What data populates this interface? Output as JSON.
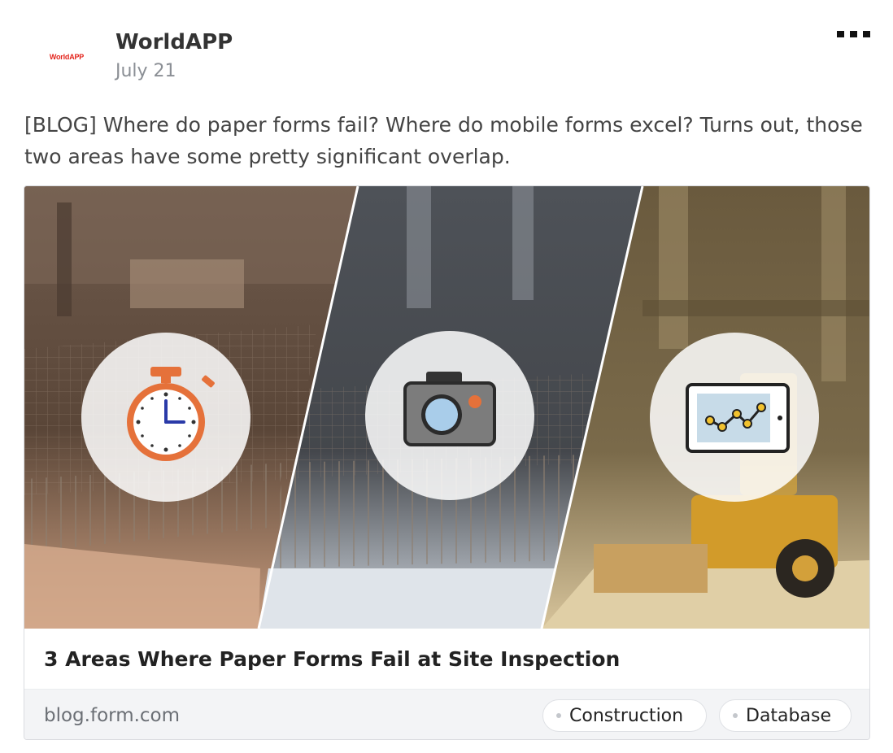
{
  "post": {
    "author": "WorldAPP",
    "logo_text": "WorldAPP",
    "date": "July 21",
    "more_icon": "more-horizontal-icon",
    "text": "[BLOG] Where do paper forms fail? Where do mobile forms excel? Turns out, those two areas have some pretty significant overlap."
  },
  "link_card": {
    "image_icons": [
      "stopwatch-icon",
      "camera-icon",
      "tablet-chart-icon"
    ],
    "title": "3 Areas Where Paper Forms Fail at Site Inspection",
    "domain": "blog.form.com",
    "tags": [
      "Construction",
      "Database"
    ]
  },
  "colors": {
    "logo_red": "#e3231b",
    "stopwatch_orange": "#e5713a",
    "camera_gray": "#7c7c7c",
    "camera_lens": "#a9cdea",
    "chart_yellow": "#f2c22e"
  }
}
